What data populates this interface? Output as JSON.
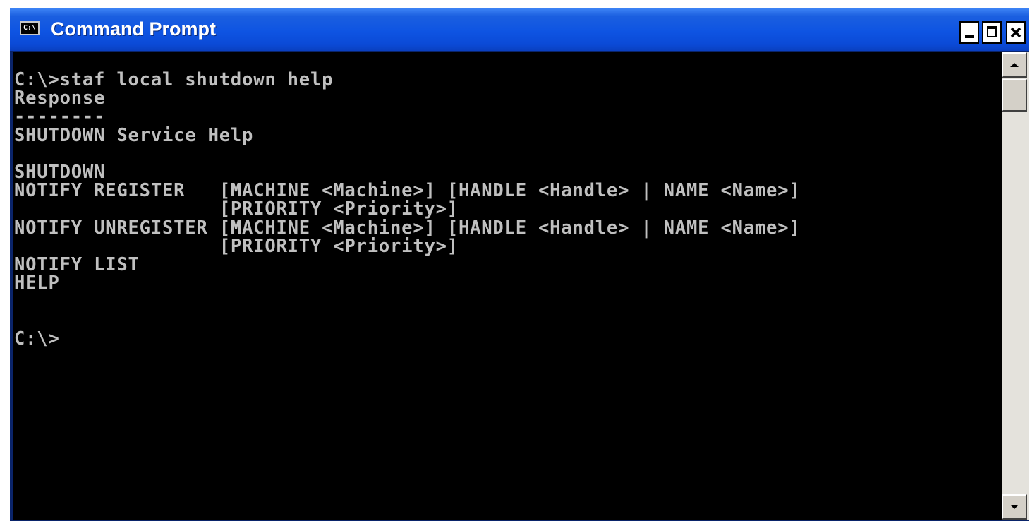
{
  "window": {
    "title": "Command Prompt",
    "icon": "cmd-icon",
    "icon_text": "C:\\"
  },
  "titlebar_buttons": {
    "minimize": "minimize-icon",
    "maximize": "maximize-icon",
    "close": "close-icon"
  },
  "console": {
    "lines": [
      "C:\\>staf local shutdown help",
      "Response",
      "--------",
      "SHUTDOWN Service Help",
      "",
      "SHUTDOWN",
      "NOTIFY REGISTER   [MACHINE <Machine>] [HANDLE <Handle> | NAME <Name>]",
      "                  [PRIORITY <Priority>]",
      "NOTIFY UNREGISTER [MACHINE <Machine>] [HANDLE <Handle> | NAME <Name>]",
      "                  [PRIORITY <Priority>]",
      "NOTIFY LIST",
      "HELP",
      "",
      "",
      "C:\\>"
    ]
  },
  "colors": {
    "console_background": "#000000",
    "console_text": "#c0c0c0",
    "titlebar": "#0e54e2"
  }
}
